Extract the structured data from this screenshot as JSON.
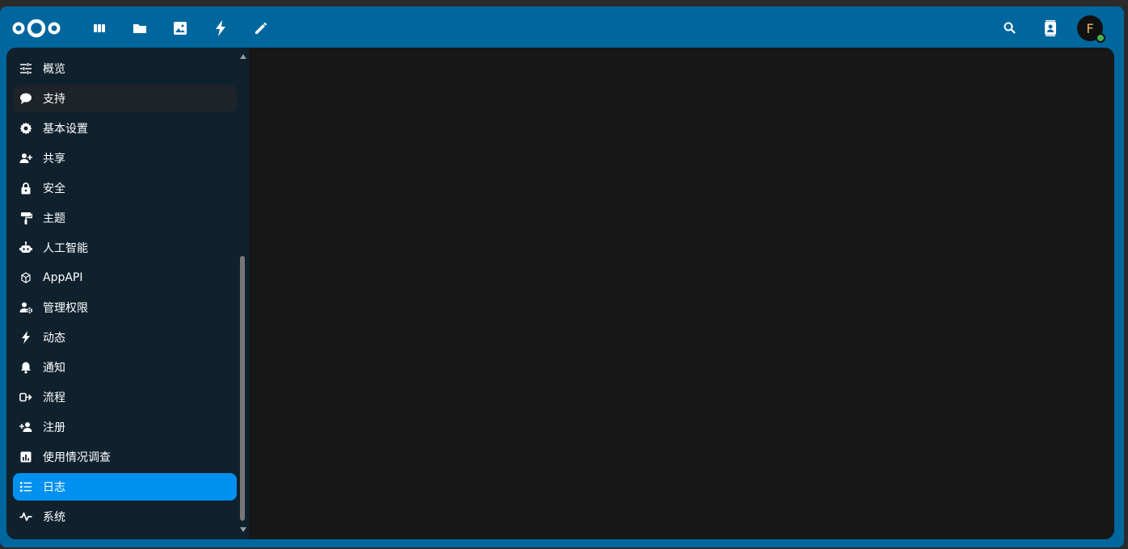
{
  "header": {
    "apps": [
      {
        "icon": "deck-icon"
      },
      {
        "icon": "folder-icon"
      },
      {
        "icon": "photos-icon"
      },
      {
        "icon": "activity-icon"
      },
      {
        "icon": "pencil-icon"
      }
    ],
    "right": [
      {
        "icon": "search-icon"
      },
      {
        "icon": "contacts-icon"
      }
    ],
    "avatar_letter": "F",
    "status_color": "#4caf50"
  },
  "sidebar": {
    "items": [
      {
        "label": "概览",
        "icon": "tune-icon"
      },
      {
        "label": "支持",
        "icon": "chat-bubble-icon"
      },
      {
        "label": "基本设置",
        "icon": "gear-icon"
      },
      {
        "label": "共享",
        "icon": "share-user-icon"
      },
      {
        "label": "安全",
        "icon": "lock-icon"
      },
      {
        "label": "主题",
        "icon": "paint-roller-icon"
      },
      {
        "label": "人工智能",
        "icon": "robot-icon"
      },
      {
        "label": "AppAPI",
        "icon": "cube-icon"
      },
      {
        "label": "管理权限",
        "icon": "user-cog-icon"
      },
      {
        "label": "动态",
        "icon": "lightning-icon"
      },
      {
        "label": "通知",
        "icon": "bell-icon"
      },
      {
        "label": "流程",
        "icon": "flow-icon"
      },
      {
        "label": "注册",
        "icon": "add-user-icon"
      },
      {
        "label": "使用情况调查",
        "icon": "bar-chart-icon"
      },
      {
        "label": "日志",
        "icon": "list-icon"
      },
      {
        "label": "系统",
        "icon": "pulse-icon"
      }
    ],
    "active_index": 14,
    "hover_index": 1
  },
  "colors": {
    "header_bg": "#00679e",
    "sidebar_bg": "#10212e",
    "active_bg": "#0091f0",
    "main_bg": "#171717"
  }
}
